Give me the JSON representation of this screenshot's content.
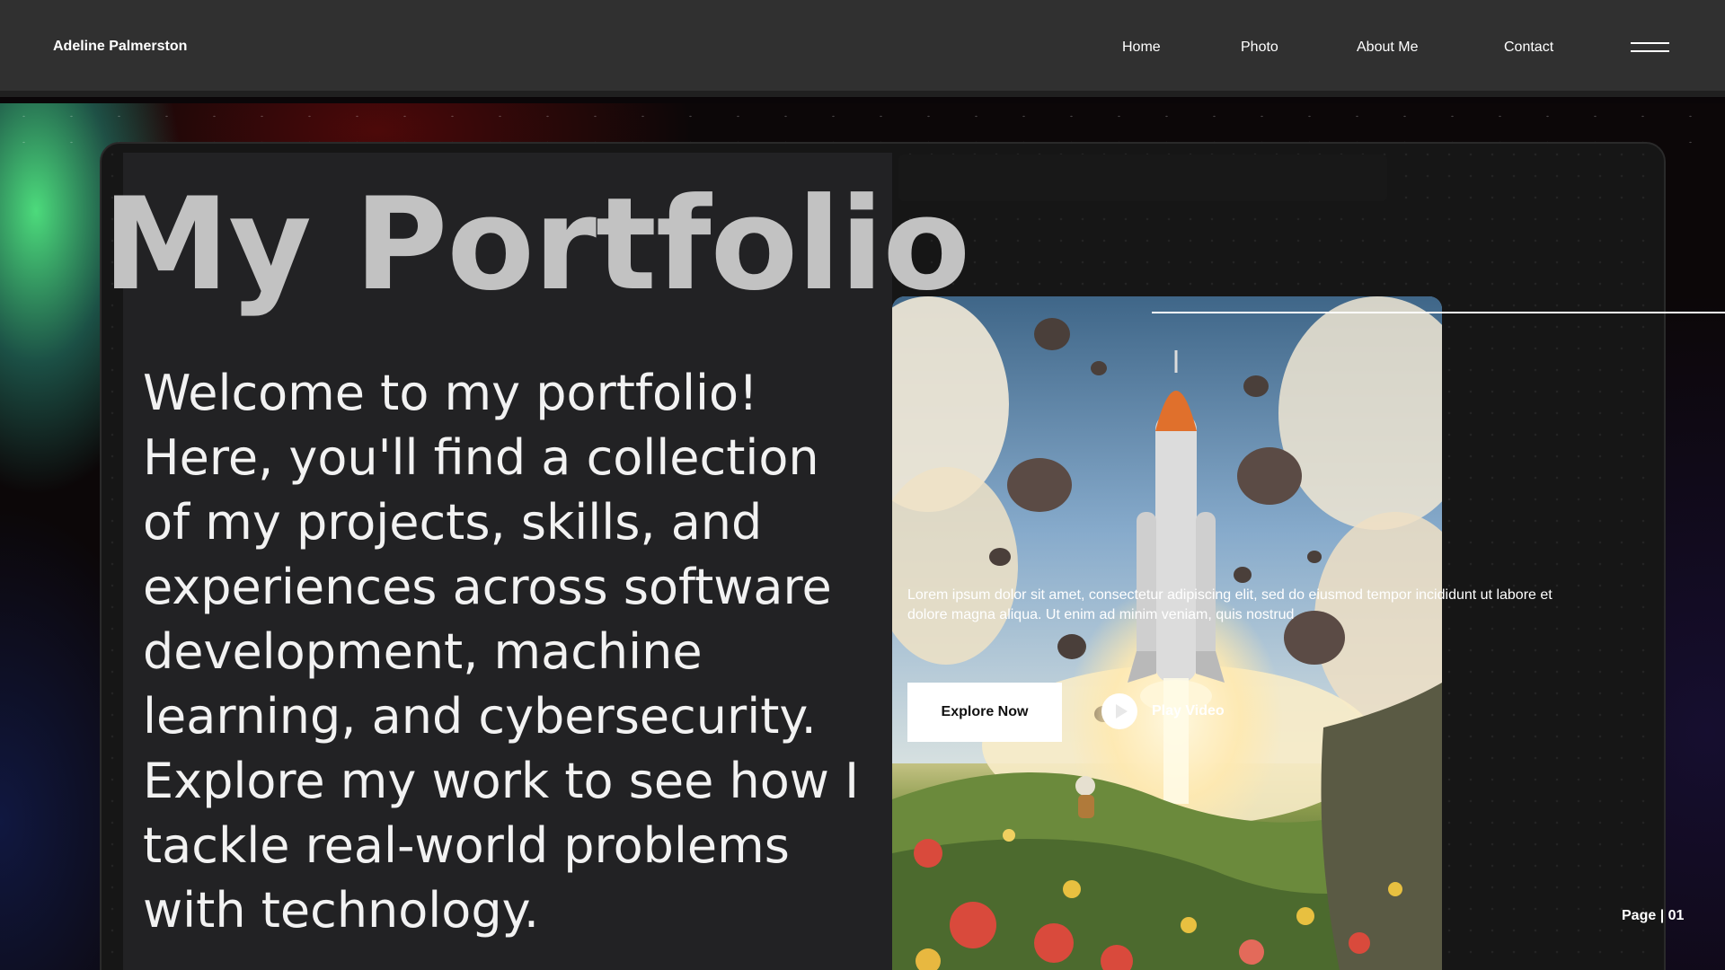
{
  "header": {
    "brand": "Adeline Palmerston",
    "nav": [
      "Home",
      "Photo",
      "About Me",
      "Contact"
    ],
    "menu_icon": "hamburger-icon"
  },
  "hero": {
    "title": "My Portfolio",
    "intro": "Welcome to my portfolio! Here, you'll find a collection of my projects, skills, and experiences across software development, machine learning, and cybersecurity. Explore my work to see how I tackle real-world problems with technology."
  },
  "feature": {
    "image_subject": "rocket-launch-illustration",
    "description": "Lorem ipsum dolor sit amet, consectetur adipiscing elit, sed do eiusmod tempor incididunt ut labore et dolore magna aliqua. Ut enim ad minim veniam, quis nostrud",
    "primary_button": "Explore Now",
    "video_button": "Play Video",
    "play_icon": "play-icon"
  },
  "footer": {
    "page": "Page | 01"
  },
  "colors": {
    "nav_bg": "#303030",
    "panel_bg": "#161616",
    "left_col_bg": "#222224",
    "title": "#c2c2c2",
    "text": "#ffffff"
  }
}
